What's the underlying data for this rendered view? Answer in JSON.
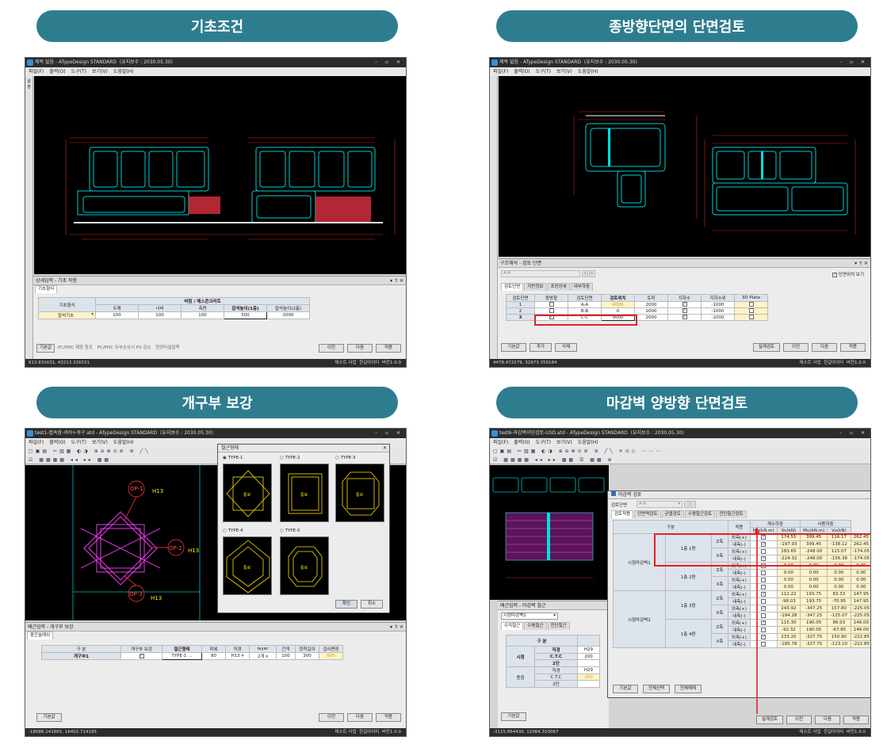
{
  "headings": {
    "tl": "기초조건",
    "tr": "종방향단면의 단면검토",
    "bl": "개구부 보강",
    "br": "마감벽 양방향 단면검토"
  },
  "colors": {
    "pill": "#2e7d8f",
    "highlight": "#e0202a",
    "cad_cyan": "#00d0d0",
    "cad_magenta": "#ff40ff",
    "cad_yellow": "#ffee00"
  },
  "menu": [
    "파일(F)",
    "출력(O)",
    "도구(T)",
    "보기(V)",
    "도움말(H)"
  ],
  "common": {
    "company": "테스트 사업",
    "user": "한길아이티",
    "version": "버전1.0.0",
    "prev": "이전",
    "next": "다음",
    "apply": "적용",
    "default": "기본값"
  },
  "win1": {
    "title": "제목 없음 - ATypeDesign STANDARD",
    "license": "(유지보수 : 2030.05.30)",
    "side_label": "설정",
    "panel_title": "상세입력 - 기초 작용",
    "tab": "기초형식",
    "table": {
      "row_label": "기초형식",
      "group": "버림 / 메스콘크리트",
      "headers": [
        "두께",
        "너비",
        "측면",
        "잡석높이(1층)",
        "잡석높이(2층)"
      ],
      "row": {
        "type": "잡석기초",
        "values": [
          "100",
          "100",
          "100",
          "500",
          "2000"
        ]
      }
    },
    "bottom_tabs": [
      "기본값",
      "PC/PHC 제원 참조",
      "PC/PHC 두부손상시 PS 감소",
      "현장타설말뚝"
    ],
    "coords": "613.831631,  43213.326531"
  },
  "win2": {
    "title": "제목 없음 - ATypeDesign STANDARD",
    "license": "(유지보수 : 2030.05.30)",
    "panel_title": "구조해석 - 검토 단면",
    "selector": "A-A",
    "show_position": "단면위치 보기",
    "tabs": [
      "검토단면",
      "지반정보",
      "포장상세",
      "내부하중"
    ],
    "headers": [
      "검토단면",
      "종방향",
      "검토단면",
      "검토위치",
      "토피",
      "지하수",
      "지하수위",
      "3D Plate"
    ],
    "rows": [
      {
        "no": "1",
        "sec": "A-A",
        "pos": "4000",
        "cover": "2000",
        "gwl": "-1000"
      },
      {
        "no": "2",
        "sec": "B-B",
        "pos": "0",
        "cover": "2000",
        "gwl": "-1000"
      },
      {
        "no": "3",
        "sec": "C-C",
        "pos": "5000",
        "cover": "2000",
        "gwl": "-1000"
      }
    ],
    "buttons": {
      "add": "추가",
      "del": "삭제",
      "design": "설계검토"
    },
    "coords": "4478.472279,  32973.359184"
  },
  "win3": {
    "title": "test1-접속함-여러+개구.atd - ATypeDesign STANDARD",
    "license": "(유지보수 : 2030.05.30)",
    "dialog_title": "철근형태",
    "types": [
      "TYPE-1",
      "TYPE-2",
      "TYPE-3",
      "TYPE-4",
      "TYPE-5"
    ],
    "thumb_label": "통로",
    "ok": "확인",
    "cancel": "취소",
    "cad_labels": {
      "op1": "OP-1",
      "op2": "OP-2",
      "op3": "OP-3",
      "h13": "H13"
    },
    "panel_title": "배근입력 - 개구부 보강",
    "tab": "중간슬래브",
    "headers": [
      "구 분",
      "개구부 보강",
      "철근형태",
      "피복",
      "직경",
      "layer",
      "간격",
      "정착길이",
      "겹사면장"
    ],
    "row": {
      "name": "개구부1",
      "type": "TYPE-1",
      "cover": "80",
      "dia": "H13",
      "layer": "2개",
      "spacing": "100",
      "anchor": "300",
      "lap": "600"
    },
    "coords": "-18086.141665,  16402.714195"
  },
  "win4": {
    "title": "test6-마감벽이단검토-USD.atd - ATypeDesign STANDARD",
    "license": "(유지보수 : 2030.05.30)",
    "panel_title": "배근입력 - 마감벽 철근",
    "selector": "시점마감벽1",
    "tabs": [
      "수직철근",
      "수평철근",
      "전단철근"
    ],
    "left_table": {
      "header": "구 분",
      "rows": [
        {
          "g": "시점",
          "k": "직경",
          "v": "H29"
        },
        {
          "g": "",
          "k": "C.T.C",
          "v": "200"
        },
        {
          "g": "",
          "k": "2단",
          "v": ""
        },
        {
          "g": "종점",
          "k": "직경",
          "v": "H29"
        },
        {
          "g": "",
          "k": "C.T.C",
          "v": "200"
        },
        {
          "g": "",
          "k": "2단",
          "v": ""
        }
      ]
    },
    "dialog": {
      "title": "마감벽 검토",
      "selector_label": "검토단면",
      "selector": "A-A",
      "tabs": [
        "검토적용",
        "단면력검토",
        "균열검토",
        "수평철근검토",
        "전단철근검토"
      ],
      "h_gubun": "구분",
      "h_apply": "적용",
      "h_factored": "계수하중",
      "h_service": "사용하중",
      "units": [
        "Mu(kN.m)",
        "Vu(kN)",
        "Mu(kN.m)",
        "Vu(kN)"
      ],
      "wall1": "시점마감벽1",
      "wall2": "시점마감벽2",
      "floors": [
        "1층 1편",
        "1층 2편",
        "1층 3편",
        "1층 4편"
      ],
      "axes": [
        "Z축",
        "X축"
      ],
      "faces": [
        "외측(+)",
        "내측(-)"
      ],
      "rows": [
        {
          "c": true,
          "v": [
            "174.55",
            "399.45",
            "116.17",
            "262.45"
          ]
        },
        {
          "c": true,
          "v": [
            "-197.93",
            "399.45",
            "-138.12",
            "262.45"
          ]
        },
        {
          "c": false,
          "v": [
            "183.65",
            "-248.00",
            "115.07",
            "-174.05"
          ]
        },
        {
          "c": true,
          "v": [
            "-224.32",
            "-248.00",
            "-156.38",
            "-174.05"
          ]
        },
        {
          "c": false,
          "v": [
            "0.00",
            "0.00",
            "0.00",
            "0.00"
          ]
        },
        {
          "c": false,
          "v": [
            "0.00",
            "0.00",
            "0.00",
            "0.00"
          ]
        },
        {
          "c": false,
          "v": [
            "0.00",
            "0.00",
            "0.00",
            "0.00"
          ]
        },
        {
          "c": false,
          "v": [
            "0.00",
            "0.00",
            "0.00",
            "0.00"
          ]
        },
        {
          "c": true,
          "v": [
            "112.22",
            "193.75",
            "83.33",
            "147.95"
          ]
        },
        {
          "c": false,
          "v": [
            "-98.03",
            "193.75",
            "-70.95",
            "147.95"
          ]
        },
        {
          "c": true,
          "v": [
            "243.92",
            "-347.25",
            "157.80",
            "-225.05"
          ]
        },
        {
          "c": false,
          "v": [
            "-194.28",
            "-347.25",
            "-125.07",
            "-225.05"
          ]
        },
        {
          "c": true,
          "v": [
            "115.30",
            "190.05",
            "86.03",
            "146.00"
          ]
        },
        {
          "c": false,
          "v": [
            "-92.32",
            "190.05",
            "-67.85",
            "146.00"
          ]
        },
        {
          "c": true,
          "v": [
            "233.20",
            "-327.75",
            "150.90",
            "-222.85"
          ]
        },
        {
          "c": false,
          "v": [
            "-185.78",
            "-327.75",
            "-123.10",
            "-222.85"
          ]
        }
      ],
      "btn_default": "기본값",
      "btn_select_all": "전체선택",
      "btn_clear_all": "전체해제"
    },
    "design": "설계검토",
    "coords": "-3115.864430,  11064.310067"
  }
}
